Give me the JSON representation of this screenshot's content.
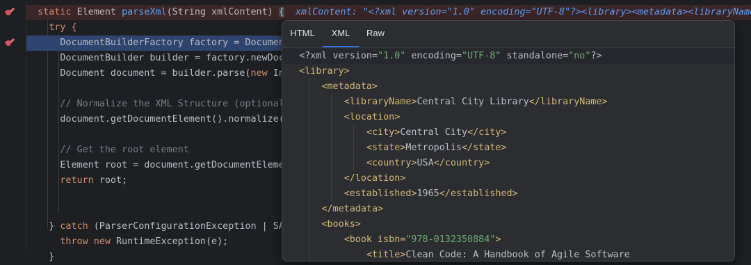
{
  "editor": {
    "signature": {
      "kw": "static ",
      "type": "Element ",
      "method": "parseXml",
      "params": "(String xmlContent) ",
      "brace": "{",
      "inline_value": "xmlContent: \"<?xml version=\"1.0\" encoding=\"UTF-8\"?><library><metadata><libraryName>Ce"
    },
    "l_try": "try {",
    "l_factory_type": "DocumentBuilderFactory factory = Document",
    "l_builder": "DocumentBuilder builder = factory.newDocu",
    "l_document_a": "Document document = builder.parse(",
    "l_document_kw": "new",
    "l_document_b": " Inp",
    "l_comment1": "// Normalize the XML Structure (optional,",
    "l_normalize": "document.getDocumentElement().normalize()",
    "l_comment2": "// Get the root element",
    "l_root": "Element root = document.getDocumentElemen",
    "l_return_kw": "return",
    "l_return_rest": " root;",
    "l_catch_a": "} ",
    "l_catch_kw": "catch",
    "l_catch_b": " (ParserConfigurationException | SAX",
    "l_throw_kw": "throw",
    "l_throw_new": " new",
    "l_throw_rest": " RuntimeException(e);",
    "l_close": "}"
  },
  "popup": {
    "tabs": [
      {
        "label": "HTML"
      },
      {
        "label": "XML"
      },
      {
        "label": "Raw"
      }
    ],
    "active_tab": "XML",
    "xml": {
      "decl_a": "<?xml version=",
      "decl_v1": "\"1.0\"",
      "decl_b": " encoding=",
      "decl_v2": "\"UTF-8\"",
      "decl_c": " standalone=",
      "decl_v3": "\"no\"",
      "decl_d": "?>",
      "library_open": "<library>",
      "metadata_open": "<metadata>",
      "libraryName_open": "<libraryName>",
      "libraryName_text": "Central City Library",
      "libraryName_close": "</libraryName>",
      "location_open": "<location>",
      "city_open": "<city>",
      "city_text": "Central City",
      "city_close": "</city>",
      "state_open": "<state>",
      "state_text": "Metropolis",
      "state_close": "</state>",
      "country_open": "<country>",
      "country_text": "USA",
      "country_close": "</country>",
      "location_close": "</location>",
      "established_open": "<established>",
      "established_text": "1965",
      "established_close": "</established>",
      "metadata_close": "</metadata>",
      "books_open": "<books>",
      "book_open_a": "<book isbn=",
      "book_isbn": "\"978-0132350884\"",
      "book_open_b": ">",
      "title_open": "<title>",
      "title_text": "Clean Code: A Handbook of Agile Software"
    }
  },
  "colors": {
    "background": "#1e1f22",
    "keyword": "#cf8e6d",
    "method": "#56a8f5",
    "xml_tag": "#d5b778",
    "xml_value": "#6aab73",
    "execution_line": "#2e436e",
    "breakpoint_line": "#3a2527",
    "accent": "#3574f0"
  }
}
